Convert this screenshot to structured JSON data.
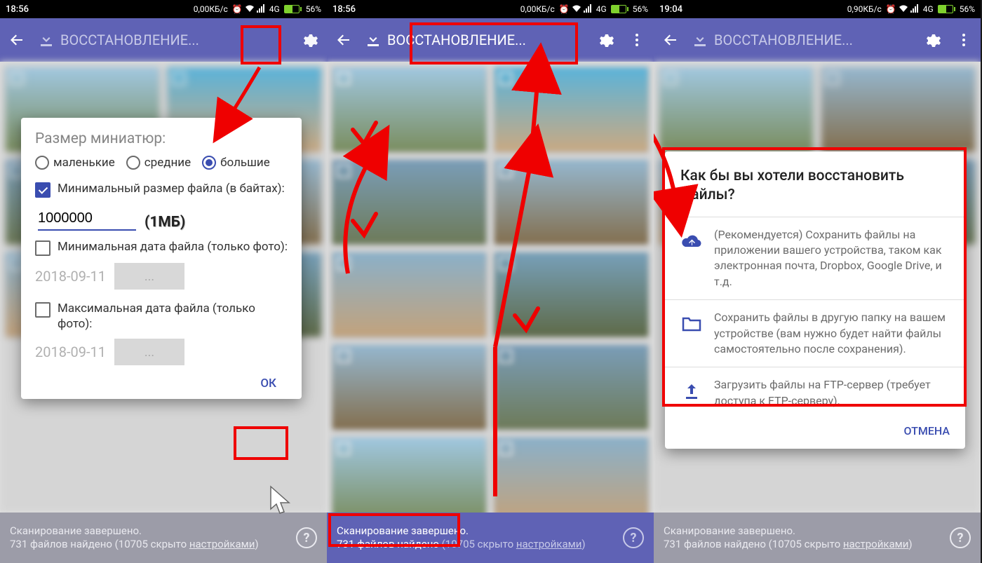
{
  "screen1": {
    "status": {
      "time": "18:56",
      "data": "0,00КБ/с",
      "net": "4G",
      "battery": "56%"
    },
    "app_title": "ВОССТАНОВЛЕНИЕ...",
    "dialog": {
      "title": "Размер миниатюр:",
      "radio_small": "маленькие",
      "radio_medium": "средние",
      "radio_large": "большие",
      "min_size_label": "Минимальный размер файла (в байтах):",
      "min_size_value": "1000000",
      "one_mb_label": "(1МБ)",
      "min_date_label": "Минимальная дата файла (только фото):",
      "min_date_value": "2018-09-11",
      "min_date_btn": "...",
      "max_date_label": "Максимальная дата файла (только фото):",
      "max_date_value": "2018-09-11",
      "max_date_btn": "...",
      "ok": "ОК"
    },
    "bottom": {
      "line1": "Сканирование завершено.",
      "line2a": "731 файлов найдено (10705 скрыто ",
      "line2b": "настройками",
      "line2c": ")"
    }
  },
  "screen2": {
    "status": {
      "time": "18:56",
      "data": "0,00КБ/с",
      "net": "4G",
      "battery": "56%"
    },
    "app_title": "ВОССТАНОВЛЕНИЕ...",
    "bottom": {
      "line1": "Сканирование завершено.",
      "line2a": "731 файлов найдено ",
      "line2b": "(10705 скрыто ",
      "line2c": "настройками",
      "line2d": ")"
    }
  },
  "screen3": {
    "status": {
      "time": "19:04",
      "data": "0,90КБ/с",
      "net": "4G",
      "battery": "56%"
    },
    "app_title": "ВОССТАНОВЛЕНИЕ...",
    "dialog": {
      "title": "Как бы вы хотели восстановить файлы?",
      "opt1": "(Рекомендуется) Сохранить файлы на приложении вашего устройства, таком как электронная почта, Dropbox, Google Drive, и т.д.",
      "opt2": "Сохранить файлы в другую папку на вашем устройстве (вам нужно будет найти файлы самостоятельно после сохранения).",
      "opt3": "Загрузить файлы на FTP-сервер (требует доступа к FTP-серверу).",
      "cancel": "ОТМЕНА"
    },
    "bottom": {
      "line1": "Сканирование завершено.",
      "line2a": "731 файлов найдено (10705 скрыто ",
      "line2b": "настройками",
      "line2c": ")"
    }
  },
  "help_q": "?"
}
